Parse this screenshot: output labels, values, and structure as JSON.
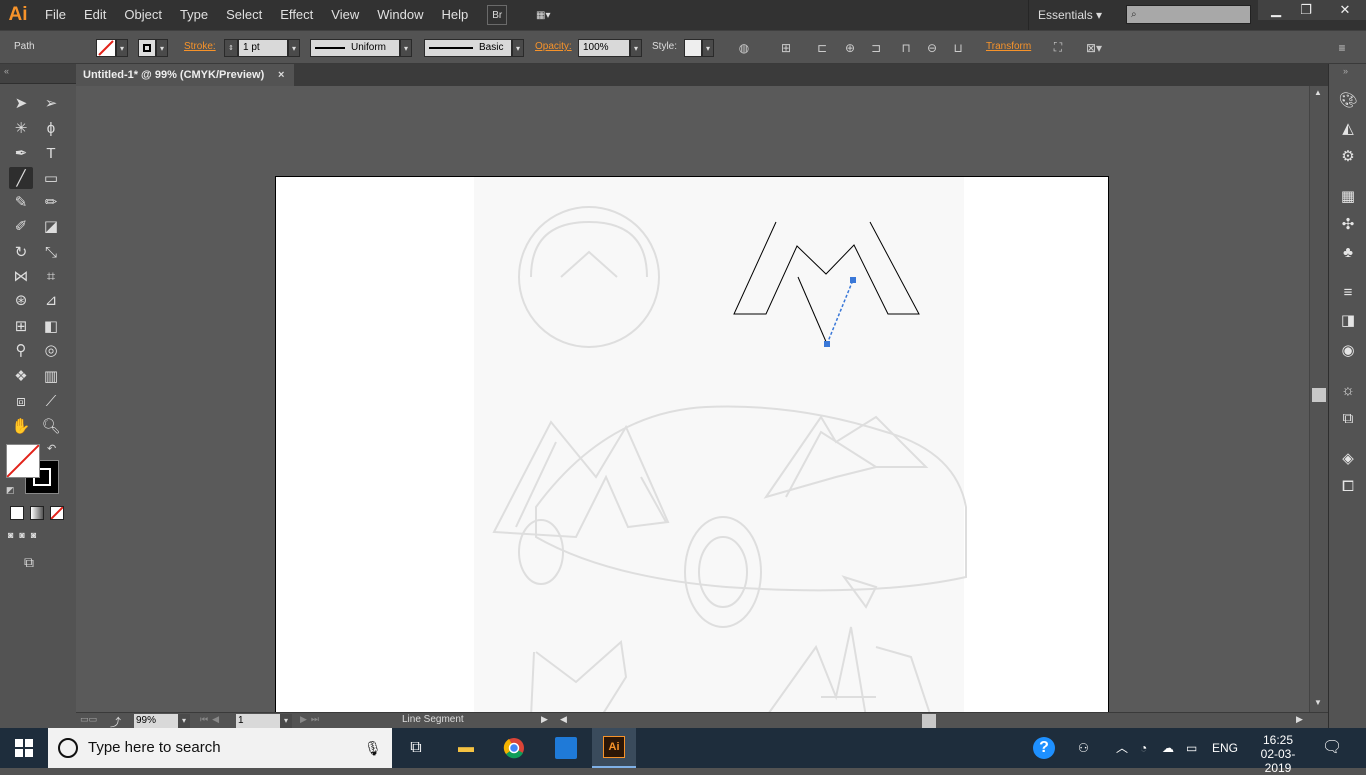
{
  "app": {
    "logo": "Ai"
  },
  "menu": [
    "File",
    "Edit",
    "Object",
    "Type",
    "Select",
    "Effect",
    "View",
    "Window",
    "Help"
  ],
  "menubar": {
    "bridge_label": "Br",
    "workspace": "Essentials"
  },
  "control": {
    "selection_type": "Path",
    "stroke_label": "Stroke:",
    "stroke_weight": "1 pt",
    "profile": "Uniform",
    "brush": "Basic",
    "opacity_label": "Opacity:",
    "opacity": "100%",
    "style_label": "Style:",
    "transform_label": "Transform"
  },
  "document": {
    "tab_title": "Untitled-1* @ 99% (CMYK/Preview)",
    "tab_close": "×"
  },
  "status": {
    "zoom": "99%",
    "artboard": "1",
    "tool_info": "Line Segment"
  },
  "taskbar": {
    "search_placeholder": "Type here to search",
    "language": "ENG",
    "time": "16:25",
    "date": "02-03-2019"
  },
  "colors": {
    "accent": "#f7932a",
    "path_selection": "#3a78d8",
    "taskbar": "#1e2d3c"
  }
}
